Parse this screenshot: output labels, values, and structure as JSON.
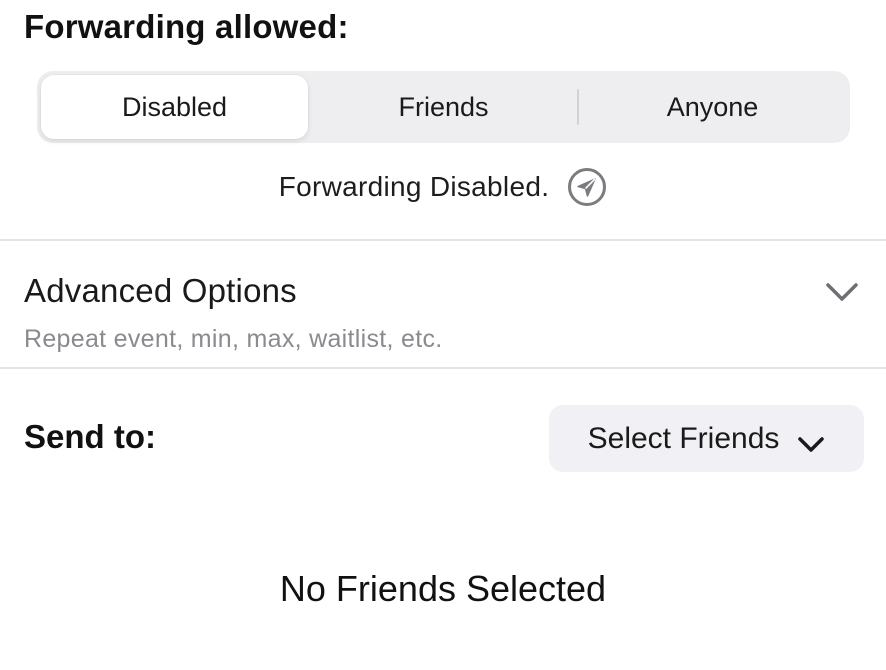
{
  "forwarding": {
    "title": "Forwarding allowed:",
    "options": [
      "Disabled",
      "Friends",
      "Anyone"
    ],
    "selected": "Disabled",
    "status_text": "Forwarding Disabled.",
    "status_icon": "paper-plane-circle-icon"
  },
  "advanced": {
    "title": "Advanced Options",
    "subtitle": "Repeat event, min, max, waitlist, etc.",
    "icon": "chevron-down-icon"
  },
  "send_to": {
    "label": "Send to:",
    "select_label": "Select Friends",
    "select_icon": "chevron-down-icon",
    "empty_text": "No Friends Selected"
  },
  "colors": {
    "segment_bg": "#eeeef0",
    "select_bg": "#f0f0f5",
    "secondary_text": "#8a8a8f",
    "divider": "#e3e3e6"
  }
}
